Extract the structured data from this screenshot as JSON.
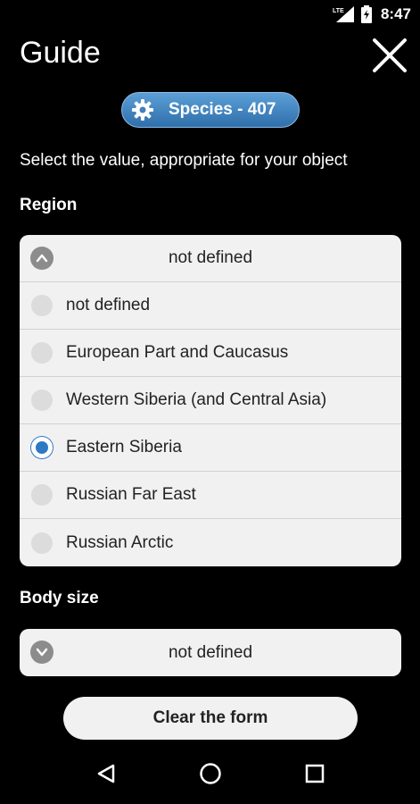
{
  "status_bar": {
    "network": "LTE",
    "time": "8:47"
  },
  "header": {
    "title": "Guide",
    "close_icon": "close-icon"
  },
  "species": {
    "label": "Species - 407",
    "icon": "gear-icon"
  },
  "instruction": "Select the value, appropriate for your object",
  "region": {
    "label": "Region",
    "selected_display": "not defined",
    "options": [
      {
        "label": "not defined",
        "selected": false
      },
      {
        "label": "European Part and Caucasus",
        "selected": false
      },
      {
        "label": "Western Siberia (and Central Asia)",
        "selected": false
      },
      {
        "label": "Eastern Siberia",
        "selected": true
      },
      {
        "label": "Russian Far East",
        "selected": false
      },
      {
        "label": "Russian Arctic",
        "selected": false
      }
    ]
  },
  "body_size": {
    "label": "Body size",
    "selected_display": "not defined"
  },
  "clear_button": "Clear the form",
  "colors": {
    "accent": "#2f78c4",
    "pill_top": "#5c9fd6",
    "pill_bottom": "#2f6fab",
    "panel_bg": "#f1f1f1"
  }
}
